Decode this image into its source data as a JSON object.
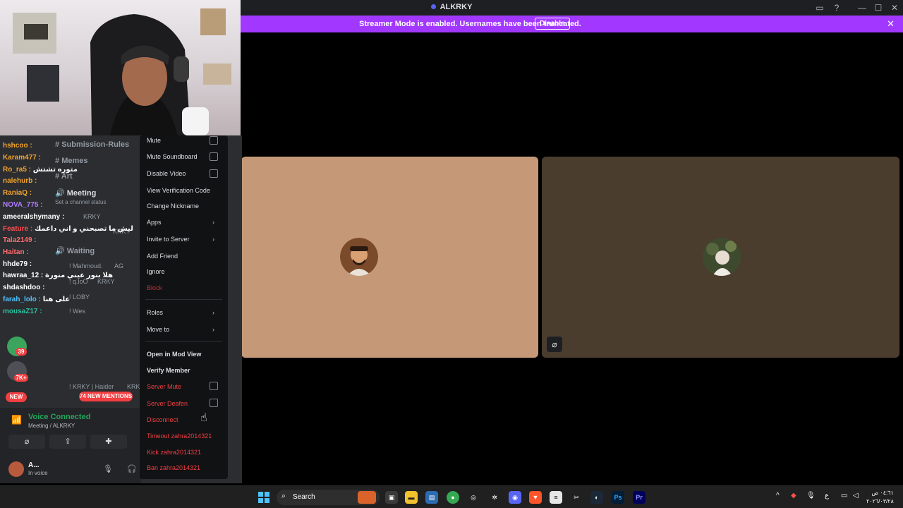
{
  "window": {
    "title": "ALKRKY"
  },
  "banner": {
    "message": "Streamer Mode is enabled. Usernames have been truncated.",
    "disable_label": "Disable"
  },
  "channels": [
    "Submission-Rules",
    "Memes",
    "Art",
    "Meeting",
    "Waiting"
  ],
  "channel_status_placeholder": "Set a channel status",
  "chat": [
    {
      "user": "hshcoo :",
      "msg": ""
    },
    {
      "user": "Karam477 :",
      "msg": ""
    },
    {
      "user": "Ro_ra5 :",
      "msg": "متوره تشتش"
    },
    {
      "user": "nalehurb :",
      "msg": ""
    },
    {
      "user": "RaniaQ :",
      "msg": ""
    },
    {
      "user": "NOVA_775 :",
      "msg": ""
    },
    {
      "user": "ameeralshymany :",
      "msg": ""
    },
    {
      "user": "Feature :",
      "msg": "ليش ما تصبحني و اني داعمك"
    },
    {
      "user": "Tala2149 :",
      "msg": ""
    },
    {
      "user": "Haitan :",
      "msg": ""
    },
    {
      "user": "hhde79 :",
      "msg": ""
    },
    {
      "user": "hawraa_12 :",
      "msg": "هلا بنور عيني منورة"
    },
    {
      "user": "shdashdoo :",
      "msg": ""
    },
    {
      "user": "farah_lolo :",
      "msg": "على هنا"
    },
    {
      "user": "mousaZ17 :",
      "msg": ""
    }
  ],
  "members": [
    {
      "name": "KRKY"
    },
    {
      "name": "KRKY"
    },
    {
      "name": "! Mahmoud."
    },
    {
      "name": "AG"
    },
    {
      "name": "! q.loO"
    },
    {
      "name": "KRKY"
    },
    {
      "name": "! LOBY"
    },
    {
      "name": "! Wes"
    },
    {
      "name": "! KRKY | Haider"
    },
    {
      "name": "KRK"
    }
  ],
  "mentions_label": "74 NEW MENTIONS",
  "new_label": "NEW",
  "badges": {
    "b1": "39",
    "b2": "7K+"
  },
  "voice": {
    "status": "Voice Connected",
    "channel": "Meeting / ALKRKY",
    "user": "A...",
    "user_status": "In voice"
  },
  "context_menu": {
    "items": [
      {
        "label": "Mute",
        "type": "check"
      },
      {
        "label": "Mute Soundboard",
        "type": "check"
      },
      {
        "label": "Disable Video",
        "type": "check"
      },
      {
        "label": "View Verification Code",
        "type": "item"
      },
      {
        "label": "Change Nickname",
        "type": "item"
      },
      {
        "label": "Apps",
        "type": "submenu"
      },
      {
        "label": "Invite to Server",
        "type": "submenu"
      },
      {
        "label": "Add Friend",
        "type": "item"
      },
      {
        "label": "Ignore",
        "type": "item"
      },
      {
        "label": "Block",
        "type": "danger"
      },
      {
        "label": "Roles",
        "type": "submenu"
      },
      {
        "label": "Move to",
        "type": "submenu"
      },
      {
        "label": "Open in Mod View",
        "type": "bold"
      },
      {
        "label": "Verify Member",
        "type": "bold"
      },
      {
        "label": "Server Mute",
        "type": "danger-check"
      },
      {
        "label": "Server Deafen",
        "type": "danger-check"
      },
      {
        "label": "Disconnect",
        "type": "danger"
      },
      {
        "label": "Timeout zahra2014321",
        "type": "danger"
      },
      {
        "label": "Kick zahra2014321",
        "type": "danger"
      },
      {
        "label": "Ban zahra2014321",
        "type": "danger"
      }
    ]
  },
  "taskbar": {
    "search_label": "Search",
    "apps": [
      "Ps",
      "Pr"
    ],
    "clock": [
      "٠٤:٦١ ص",
      "٢٠٢٦/٠٣/٢٨"
    ],
    "lang": "ع"
  },
  "colors": {
    "accent": "#5865f2",
    "banner": "#a238ff",
    "danger": "#f23f42",
    "online": "#23a55a"
  }
}
